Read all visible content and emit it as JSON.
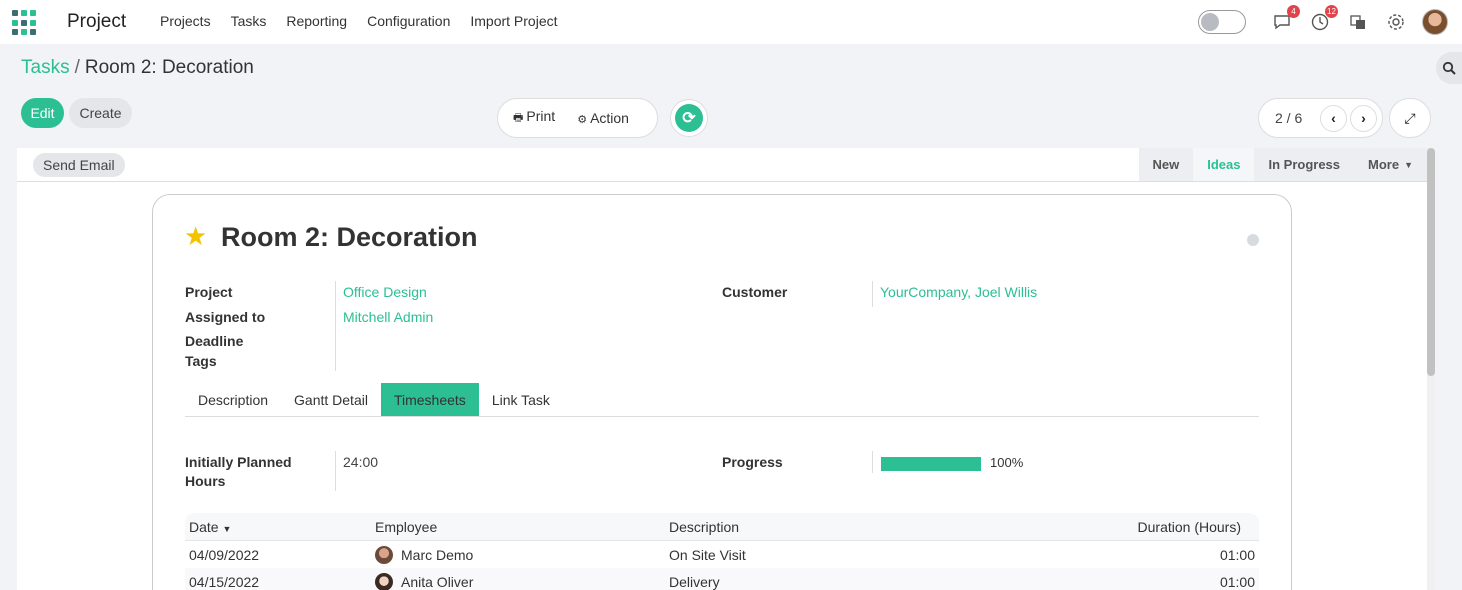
{
  "navbar": {
    "app_title": "Project",
    "menu": [
      "Projects",
      "Tasks",
      "Reporting",
      "Configuration",
      "Import Project"
    ],
    "messages_badge": "4",
    "activities_badge": "12"
  },
  "breadcrumb": {
    "parent": "Tasks",
    "separator": "/",
    "current": "Room 2: Decoration"
  },
  "control": {
    "edit_label": "Edit",
    "create_label": "Create",
    "print_label": "Print",
    "action_label": "Action",
    "pager_value": "2 / 6"
  },
  "statusbar": {
    "send_email_label": "Send Email",
    "stages": [
      "New",
      "Ideas",
      "In Progress",
      "More"
    ],
    "active_stage": "Ideas"
  },
  "task": {
    "title": "Room 2: Decoration",
    "fields": {
      "project_label": "Project",
      "project_value": "Office Design",
      "assigned_label": "Assigned to",
      "assigned_value": "Mitchell Admin",
      "deadline_label": "Deadline",
      "tags_label": "Tags",
      "customer_label": "Customer",
      "customer_value": "YourCompany, Joel Willis"
    },
    "tabs": [
      "Description",
      "Gantt Detail",
      "Timesheets",
      "Link Task"
    ],
    "active_tab": "Timesheets",
    "planned_hours_label_line1": "Initially Planned",
    "planned_hours_label_line2": "Hours",
    "planned_hours_value": "24:00",
    "progress_label": "Progress",
    "progress_text": "100%",
    "progress_fraction": 1.0
  },
  "timesheets": {
    "headers": {
      "date": "Date",
      "employee": "Employee",
      "description": "Description",
      "duration": "Duration (Hours)"
    },
    "rows": [
      {
        "date": "04/09/2022",
        "employee": "Marc Demo",
        "description": "On Site Visit",
        "duration": "01:00"
      },
      {
        "date": "04/15/2022",
        "employee": "Anita Oliver",
        "description": "Delivery",
        "duration": "01:00"
      }
    ]
  },
  "colors": {
    "accent": "#2bbf93",
    "badge": "#e0434b",
    "star": "#f3c300"
  }
}
